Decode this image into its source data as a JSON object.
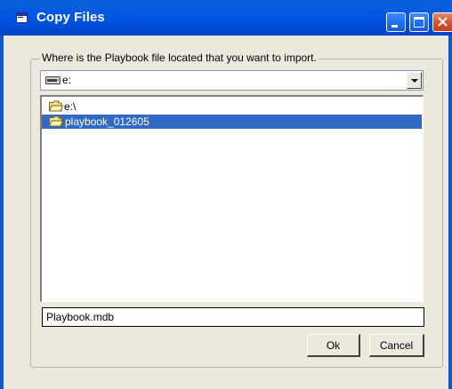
{
  "window": {
    "title": "Copy Files",
    "title_icon": "window-icon",
    "controls": [
      "minimize-icon",
      "maximize-icon",
      "close-icon"
    ]
  },
  "colors": {
    "titlebar": "#0058e6",
    "frame": "#0b57d6",
    "dialog_background": "#ebe9de",
    "selection": "#316ac5",
    "close_button": "#d9502d"
  },
  "group": {
    "label": "Where is the Playbook file located that you want to import."
  },
  "drive": {
    "selected": "e:",
    "icon": "drive-icon"
  },
  "directories": [
    {
      "label": "e:\\",
      "icon": "folder-open-icon",
      "selected": false
    },
    {
      "label": "playbook_012605",
      "icon": "folder-open-icon",
      "selected": true
    }
  ],
  "file": {
    "value": "Playbook.mdb"
  },
  "buttons": {
    "ok_label": "Ok",
    "cancel_label": "Cancel"
  }
}
